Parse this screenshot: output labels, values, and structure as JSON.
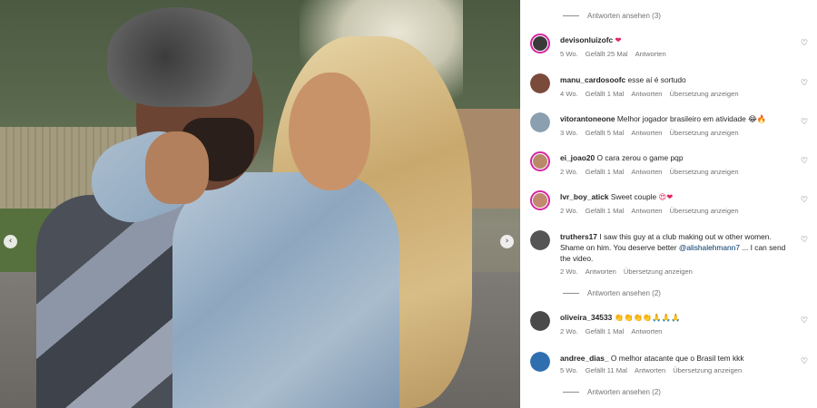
{
  "gallery": {
    "prev_icon": "‹",
    "next_icon": "›"
  },
  "comments_panel": {
    "view_replies": [
      {
        "label": "Antworten ansehen (3)"
      },
      {
        "label": "Antworten ansehen (2)"
      },
      {
        "label": "Antworten ansehen (2)"
      }
    ],
    "like_icon": "♡",
    "items": [
      {
        "username": "devisonluizofc",
        "text": "",
        "suffix": "❤",
        "age": "5 Wo.",
        "likes": "Gefällt 25 Mal",
        "reply": "Antworten",
        "translate": "",
        "avatar_color": "#3a3a3a",
        "ring": true
      },
      {
        "username": "manu_cardosoofc",
        "text": "esse aí é sortudo",
        "suffix": "",
        "age": "4 Wo.",
        "likes": "Gefällt 1 Mal",
        "reply": "Antworten",
        "translate": "Übersetzung anzeigen",
        "avatar_color": "#7a4a3a",
        "ring": false
      },
      {
        "username": "vitorantoneone",
        "text": "Melhor jogador brasileiro em atividade",
        "suffix": "😂🔥",
        "age": "3 Wo.",
        "likes": "Gefällt 5 Mal",
        "reply": "Antworten",
        "translate": "Übersetzung anzeigen",
        "avatar_color": "#8aa0b0",
        "ring": false
      },
      {
        "username": "ei_joao20",
        "text": "O cara zerou o game pqp",
        "suffix": "",
        "age": "2 Wo.",
        "likes": "Gefällt 1 Mal",
        "reply": "Antworten",
        "translate": "Übersetzung anzeigen",
        "avatar_color": "#b88a6a",
        "ring": true
      },
      {
        "username": "lvr_boy_atick",
        "text": "Sweet couple",
        "suffix": "😍❤",
        "age": "2 Wo.",
        "likes": "Gefällt 1 Mal",
        "reply": "Antworten",
        "translate": "Übersetzung anzeigen",
        "avatar_color": "#c08a70",
        "ring": true
      },
      {
        "username": "truthers17",
        "text": "I saw this guy at a club making out w other women. Shame on him. You deserve better",
        "mention": "@alishalehmann7",
        "text_after": "... I can send the video.",
        "suffix": "",
        "age": "2 Wo.",
        "likes": "",
        "reply": "Antworten",
        "translate": "Übersetzung anzeigen",
        "avatar_color": "#555555",
        "ring": false
      },
      {
        "username": "oliveira_34533",
        "text": "",
        "suffix": "👏👏👏👏🙏🙏🙏",
        "age": "2 Wo.",
        "likes": "Gefällt 1 Mal",
        "reply": "Antworten",
        "translate": "",
        "avatar_color": "#4a4a4a",
        "ring": false
      },
      {
        "username": "andree_dias_",
        "text": "O melhor atacante que o Brasil tem kkk",
        "suffix": "",
        "age": "5 Wo.",
        "likes": "Gefällt 11 Mal",
        "reply": "Antworten",
        "translate": "Übersetzung anzeigen",
        "avatar_color": "#2f6fb0",
        "ring": false
      }
    ]
  }
}
